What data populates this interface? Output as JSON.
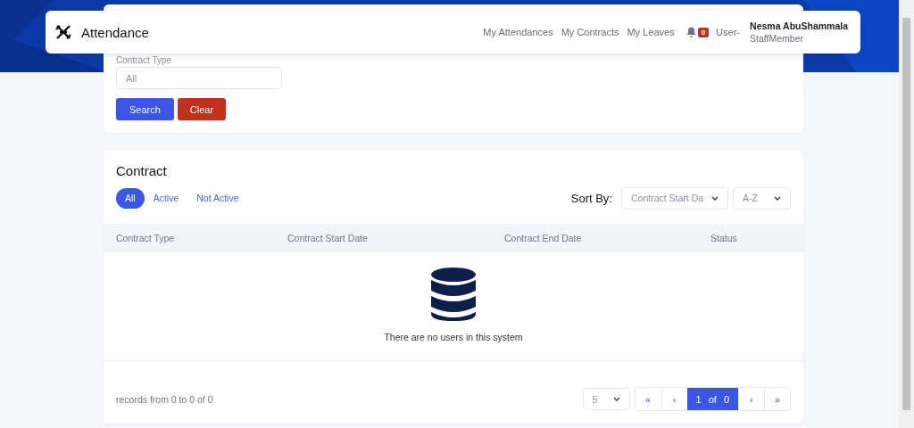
{
  "navbar": {
    "brand": "Attendance",
    "links": [
      {
        "label": "My Attendances"
      },
      {
        "label": "My Contracts"
      },
      {
        "label": "My Leaves"
      }
    ],
    "notification_count": "0",
    "avatar_alt": "User-",
    "user": {
      "name": "Nesma AbuShammala",
      "role": "StaffMember"
    }
  },
  "filter": {
    "label": "Contract Type",
    "select_value": "All",
    "buttons": [
      {
        "label": "Search",
        "kind": "primary"
      },
      {
        "label": "Clear",
        "kind": "danger"
      }
    ]
  },
  "contract": {
    "title": "Contract",
    "tabs": [
      {
        "label": "All",
        "selected": true
      },
      {
        "label": "Active",
        "selected": false
      },
      {
        "label": "Not Active",
        "selected": false
      }
    ],
    "sort_label": "Sort By:",
    "sort_field": "Contract Start Da",
    "sort_order": "A-Z",
    "columns": [
      "Contract Type",
      "Contract Start Date",
      "Contract End Date",
      "Status"
    ],
    "empty_message": "There are no users in this system",
    "records": "records from 0 to 0 of 0",
    "page_size": "5",
    "pager": {
      "first": "«",
      "prev": "‹",
      "current": "1",
      "of": "of",
      "total": "0",
      "next": "›",
      "last": "»"
    }
  }
}
